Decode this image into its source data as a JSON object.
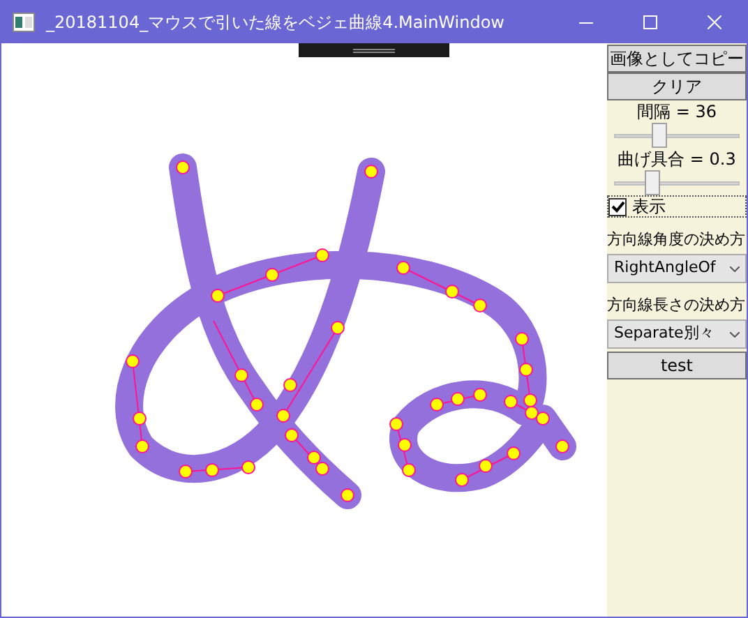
{
  "window": {
    "title": "_20181104_マウスで引いた線をベジェ曲線4.MainWindow"
  },
  "panel": {
    "buttons": [
      {
        "label": "画像としてコピー"
      },
      {
        "label": "クリア"
      }
    ],
    "sliders": [
      {
        "label": "間隔 = 36",
        "level": 0.35
      },
      {
        "label": "曲げ具合 = 0.3",
        "level": 0.3
      }
    ],
    "checkbox": {
      "label": "表示",
      "checked": true
    },
    "dropdowns": [
      {
        "label": "方向線角度の決め方",
        "value": "RightAngleOf"
      },
      {
        "label": "方向線長さの決め方",
        "value": "Separate別々"
      }
    ],
    "test_button": {
      "label": "test"
    }
  }
}
